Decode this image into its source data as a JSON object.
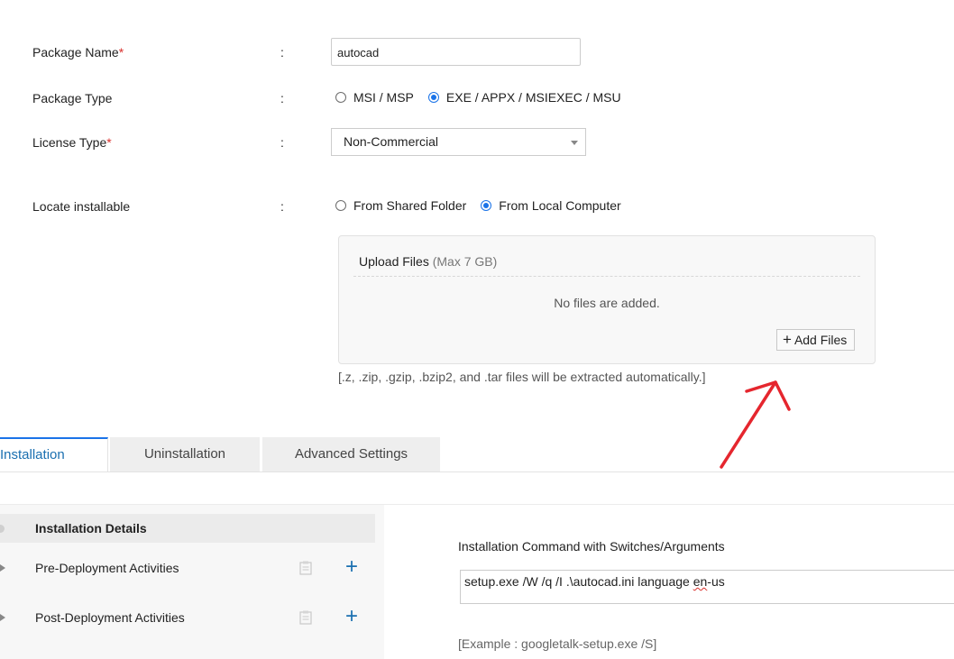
{
  "form": {
    "package_name": {
      "label": "Package Name",
      "required_mark": "*",
      "colon": ":",
      "value": "autocad"
    },
    "package_type": {
      "label": "Package Type",
      "colon": ":",
      "options": [
        "MSI / MSP",
        "EXE / APPX / MSIEXEC / MSU"
      ],
      "selected": "EXE / APPX / MSIEXEC / MSU"
    },
    "license_type": {
      "label": "License Type",
      "required_mark": "*",
      "colon": ":",
      "value": "Non-Commercial"
    },
    "locate_installable": {
      "label": "Locate installable",
      "colon": ":",
      "options": [
        "From Shared Folder",
        "From Local Computer"
      ],
      "selected": "From Local Computer"
    }
  },
  "upload": {
    "title": "Upload Files",
    "limit": "(Max 7 GB)",
    "empty_text": "No files are added.",
    "add_button": "Add Files",
    "extract_note": "[.z, .zip, .gzip, .bzip2, and .tar files will be extracted automatically.]"
  },
  "tabs": [
    {
      "label": "Installation",
      "active": true
    },
    {
      "label": "Uninstallation",
      "active": false
    },
    {
      "label": "Advanced Settings",
      "active": false
    }
  ],
  "left_panel": {
    "items": [
      {
        "label": "Installation Details"
      },
      {
        "label": "Pre-Deployment Activities"
      },
      {
        "label": "Post-Deployment Activities"
      }
    ]
  },
  "installation": {
    "command_label": "Installation Command with Switches/Arguments",
    "command_prefix": "setup.exe /W /q /I .\\autocad.ini language ",
    "command_squiggle": "en",
    "command_suffix": "-us",
    "example": "[Example : googletalk-setup.exe /S]"
  },
  "colors": {
    "accent": "#1a73e8",
    "required": "#d9302c",
    "annotation": "#e5262e"
  }
}
